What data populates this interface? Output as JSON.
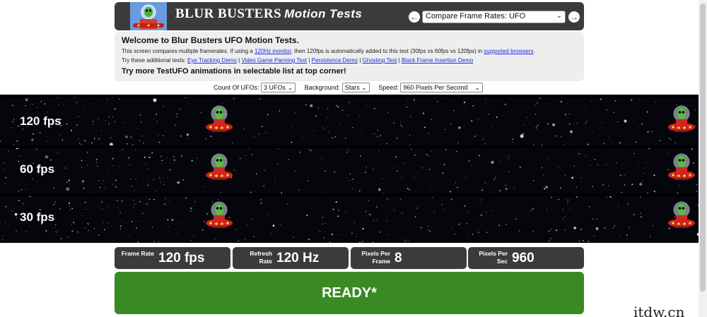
{
  "header": {
    "brand": "BLUR BUSTERS",
    "brand_sub": "Motion Tests",
    "test_select": "Compare Frame Rates: UFO"
  },
  "info": {
    "welcome": "Welcome to Blur Busters UFO Motion Tests.",
    "line1_a": "This screen compares multiple framerates. If using a ",
    "line1_link1": "120Hz monitor",
    "line1_b": ", then 120fps is automatically added to this test (30fps vs 60fps vs 120fps) in ",
    "line1_link2": "supported browsers",
    "line1_c": ".",
    "line2_prefix": "Try these additional tests: ",
    "links": [
      "Eye Tracking Demo",
      "Video Game Panning Test",
      "Persistence Demo",
      "Ghosting Test",
      "Black Frame Insertion Demo"
    ],
    "try_more": "Try more TestUFO animations in selectable list at top corner!"
  },
  "controls": {
    "count_label": "Count Of UFOs:",
    "count_value": "3 UFOs",
    "background_label": "Background:",
    "background_value": "Stars",
    "speed_label": "Speed:",
    "speed_value": "960 Pixels Per Second"
  },
  "lanes": [
    {
      "label": "120 fps"
    },
    {
      "label": "60 fps"
    },
    {
      "label": "30 fps"
    }
  ],
  "stats": {
    "frame_rate_label": "Frame Rate",
    "frame_rate_value": "120 fps",
    "refresh_label": "Refresh Rate",
    "refresh_value": "120 Hz",
    "ppf_label": "Pixels Per Frame",
    "ppf_value": "8",
    "pps_label": "Pixels Per Sec",
    "pps_value": "960"
  },
  "ready": "READY*",
  "watermark": "itdw.cn",
  "colors": {
    "header_bg": "#3b3b3b",
    "panel_bg": "#eeeeee",
    "ready_green": "#3a8a24",
    "link_blue": "#1a2fe0"
  },
  "icons": {
    "prev": "arrow-left-circle-icon",
    "next": "arrow-right-circle-icon",
    "logo": "alien-ufo-icon"
  }
}
